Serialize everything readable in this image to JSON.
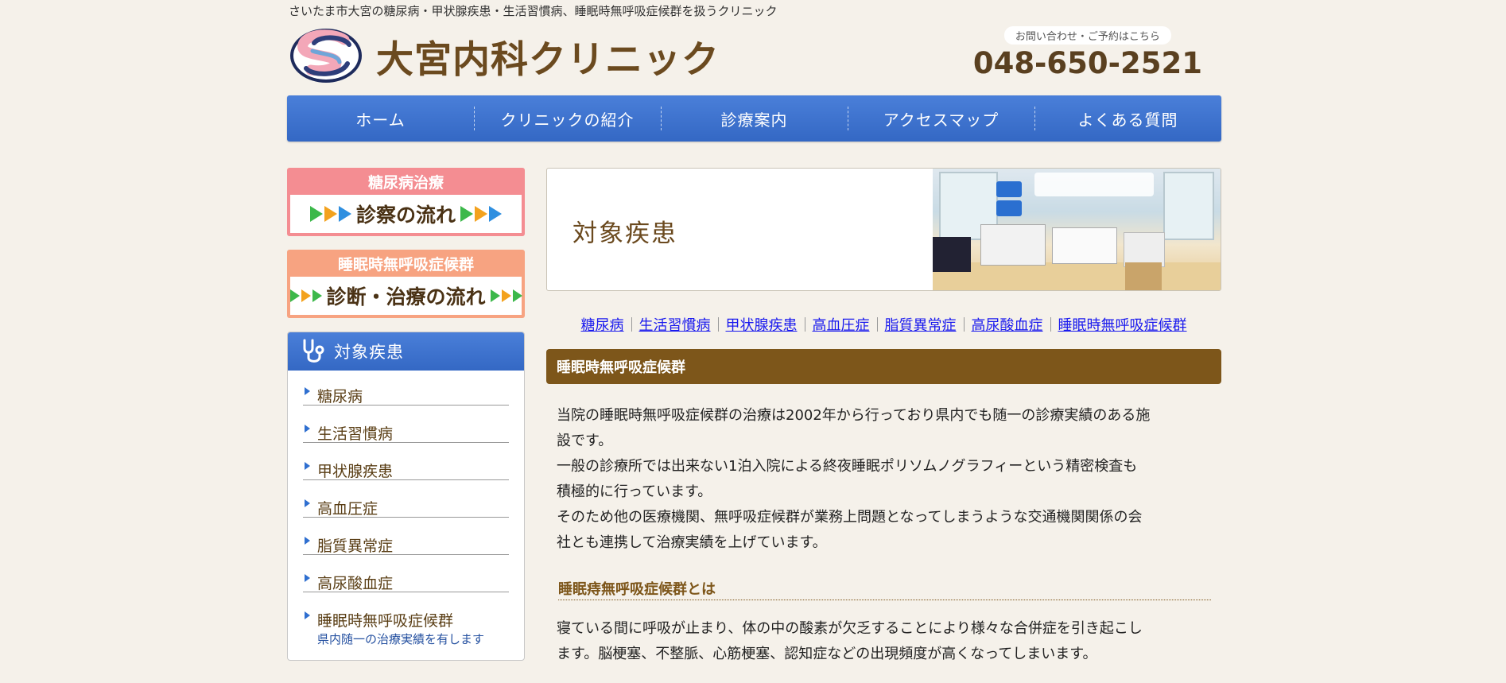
{
  "header": {
    "tagline": "さいたま市大宮の糖尿病・甲状腺疾患・生活習慣病、睡眠時無呼吸症候群を扱うクリニック",
    "logo_text": "大宮内科クリニック",
    "contact_label": "お問い合わせ・ご予約はこちら",
    "phone": "048-650-2521"
  },
  "nav": {
    "items": [
      "ホーム",
      "クリニックの紹介",
      "診療案内",
      "アクセスマップ",
      "よくある質問"
    ]
  },
  "sidebar": {
    "banner1": {
      "top": "糖尿病治療",
      "bottom": "診察の流れ"
    },
    "banner2": {
      "top": "睡眠時無呼吸症候群",
      "bottom": "診断・治療の流れ"
    },
    "diseases_title": "対象疾患",
    "diseases": [
      "糖尿病",
      "生活習慣病",
      "甲状腺疾患",
      "高血圧症",
      "脂質異常症",
      "高尿酸血症",
      "睡眠時無呼吸症候群"
    ],
    "diseases_note": "県内随一の治療実績を有します"
  },
  "main": {
    "page_title": "対象疾患",
    "links": [
      "糖尿病",
      "生活習慣病",
      "甲状腺疾患",
      "高血圧症",
      "脂質異常症",
      "高尿酸血症",
      "睡眠時無呼吸症候群"
    ],
    "section_title": "睡眠時無呼吸症候群",
    "para_lines": [
      "当院の睡眠時無呼吸症候群の治療は2002年から行っており県内でも随一の診療実績のある施",
      "設です。",
      "一般の診療所では出来ない1泊入院による終夜睡眠ポリソムノグラフィーという精密検査も",
      "積極的に行っています。",
      "そのため他の医療機関、無呼吸症候群が業務上問題となってしまうような交通機関関係の会",
      "社とも連携して治療実績を上げています。"
    ],
    "subhead": "睡眠痔無呼吸症候群とは",
    "para2_lines": [
      "寝ている間に呼吸が止まり、体の中の酸素が欠乏することにより様々な合併症を引き起こし",
      "ます。脳梗塞、不整脈、心筋梗塞、認知症などの出現頻度が高くなってしまいます。"
    ]
  },
  "colors": {
    "nav_blue": "#3f76d2",
    "brown_bar": "#7d561a",
    "banner_pink": "#f48d92",
    "banner_salmon": "#f7a381",
    "link_blue": "#1a1aee"
  },
  "icons": [
    "clinic-logo-icon",
    "stethoscope-icon",
    "triangle-arrow-icon",
    "bullet-arrow-icon"
  ]
}
